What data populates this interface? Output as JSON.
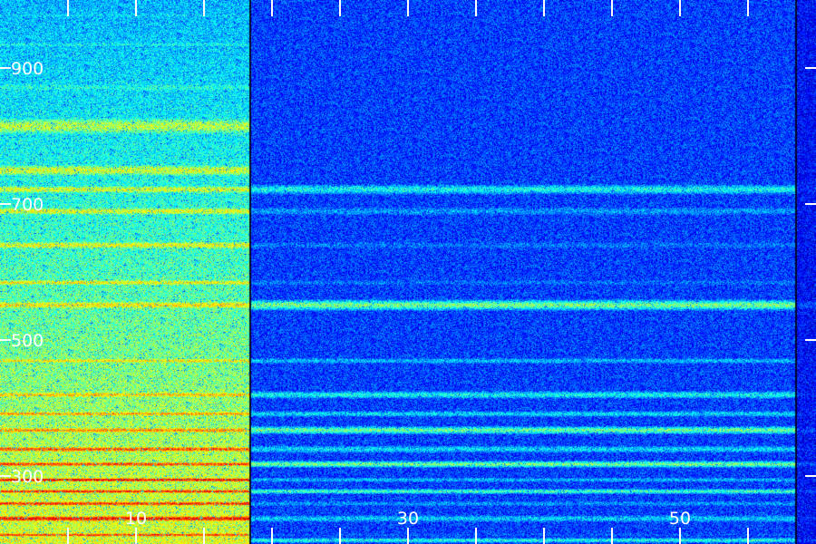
{
  "chart_data": {
    "type": "heatmap",
    "title": "",
    "xlabel": "",
    "ylabel": "",
    "colormap": "jet",
    "background": "#000010",
    "grid": false,
    "legend": "none",
    "xlim": [
      0,
      60
    ],
    "ylim": [
      200,
      1000
    ],
    "x_ticks": [
      {
        "value": 10,
        "label": "10"
      },
      {
        "value": 30,
        "label": "30"
      },
      {
        "value": 50,
        "label": "50"
      }
    ],
    "x_minor_ticks": [
      5,
      15,
      20,
      25,
      35,
      40,
      45,
      55
    ],
    "y_ticks": [
      {
        "value": 900,
        "label": "900"
      },
      {
        "value": 700,
        "label": "700"
      },
      {
        "value": 500,
        "label": "500"
      },
      {
        "value": 300,
        "label": "300"
      }
    ],
    "segments": [
      {
        "x_range": [
          0,
          18.4
        ],
        "base_intensity": 0.45,
        "note_intensity_profile": "rises toward low y"
      },
      {
        "x_range": [
          18.4,
          58.5
        ],
        "base_intensity": 0.12
      },
      {
        "x_range": [
          58.5,
          60
        ],
        "base_intensity": 0.06
      }
    ],
    "bands": [
      {
        "y": 978,
        "width": 6,
        "left": 0.3,
        "right": 0.02
      },
      {
        "y": 935,
        "width": 6,
        "left": 0.34,
        "right": 0.05
      },
      {
        "y": 872,
        "width": 12,
        "left": 0.36,
        "right": 0.1
      },
      {
        "y": 815,
        "width": 18,
        "left": 0.52,
        "right": 0.04
      },
      {
        "y": 750,
        "width": 12,
        "left": 0.55,
        "right": 0.02
      },
      {
        "y": 722,
        "width": 8,
        "left": 0.56,
        "right": 0.34
      },
      {
        "y": 690,
        "width": 8,
        "left": 0.57,
        "right": 0.22
      },
      {
        "y": 640,
        "width": 8,
        "left": 0.58,
        "right": 0.18
      },
      {
        "y": 585,
        "width": 6,
        "left": 0.6,
        "right": 0.18
      },
      {
        "y": 552,
        "width": 8,
        "left": 0.62,
        "right": 0.46
      },
      {
        "y": 470,
        "width": 5,
        "left": 0.62,
        "right": 0.26
      },
      {
        "y": 420,
        "width": 6,
        "left": 0.66,
        "right": 0.34
      },
      {
        "y": 392,
        "width": 5,
        "left": 0.7,
        "right": 0.3
      },
      {
        "y": 368,
        "width": 6,
        "left": 0.72,
        "right": 0.44
      },
      {
        "y": 340,
        "width": 6,
        "left": 0.78,
        "right": 0.3
      },
      {
        "y": 318,
        "width": 5,
        "left": 0.8,
        "right": 0.46
      },
      {
        "y": 295,
        "width": 4,
        "left": 0.88,
        "right": 0.26
      },
      {
        "y": 278,
        "width": 4,
        "left": 0.84,
        "right": 0.4
      },
      {
        "y": 260,
        "width": 5,
        "left": 0.82,
        "right": 0.22
      },
      {
        "y": 238,
        "width": 6,
        "left": 0.86,
        "right": 0.28
      },
      {
        "y": 214,
        "width": 4,
        "left": 0.8,
        "right": 0.16
      },
      {
        "y": 206,
        "width": 4,
        "left": 0.6,
        "right": 0.36
      }
    ]
  }
}
